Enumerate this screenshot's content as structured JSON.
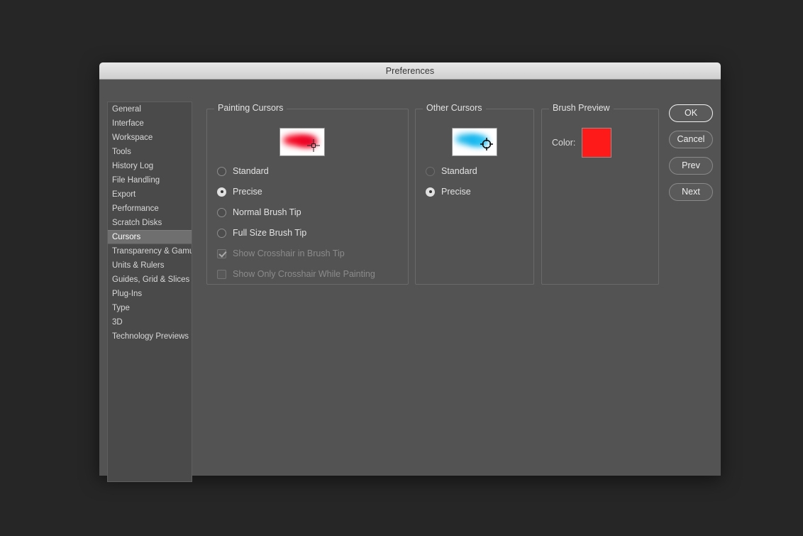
{
  "window": {
    "title": "Preferences"
  },
  "sidebar": {
    "items": [
      {
        "label": "General",
        "selected": false
      },
      {
        "label": "Interface",
        "selected": false
      },
      {
        "label": "Workspace",
        "selected": false
      },
      {
        "label": "Tools",
        "selected": false
      },
      {
        "label": "History Log",
        "selected": false
      },
      {
        "label": "File Handling",
        "selected": false
      },
      {
        "label": "Export",
        "selected": false
      },
      {
        "label": "Performance",
        "selected": false
      },
      {
        "label": "Scratch Disks",
        "selected": false
      },
      {
        "label": "Cursors",
        "selected": true
      },
      {
        "label": "Transparency & Gamut",
        "selected": false
      },
      {
        "label": "Units & Rulers",
        "selected": false
      },
      {
        "label": "Guides, Grid & Slices",
        "selected": false
      },
      {
        "label": "Plug-Ins",
        "selected": false
      },
      {
        "label": "Type",
        "selected": false
      },
      {
        "label": "3D",
        "selected": false
      },
      {
        "label": "Technology Previews",
        "selected": false
      }
    ]
  },
  "painting_cursors": {
    "legend": "Painting Cursors",
    "preview_icon": "red-brush-stroke-precise-crosshair",
    "options": [
      {
        "label": "Standard",
        "selected": false
      },
      {
        "label": "Precise",
        "selected": true
      },
      {
        "label": "Normal Brush Tip",
        "selected": false
      },
      {
        "label": "Full Size Brush Tip",
        "selected": false
      }
    ],
    "checkboxes": [
      {
        "label": "Show Crosshair in Brush Tip",
        "checked": true,
        "disabled": true
      },
      {
        "label": "Show Only Crosshair While Painting",
        "checked": false,
        "disabled": true
      }
    ]
  },
  "other_cursors": {
    "legend": "Other Cursors",
    "preview_icon": "blue-brush-stroke-target-crosshair",
    "options": [
      {
        "label": "Standard",
        "selected": false
      },
      {
        "label": "Precise",
        "selected": true
      }
    ]
  },
  "brush_preview": {
    "legend": "Brush Preview",
    "color_label": "Color:",
    "color_value": "#FF1A1A"
  },
  "buttons": [
    {
      "label": "OK",
      "primary": true
    },
    {
      "label": "Cancel",
      "primary": false
    },
    {
      "label": "Prev",
      "primary": false
    },
    {
      "label": "Next",
      "primary": false
    }
  ]
}
